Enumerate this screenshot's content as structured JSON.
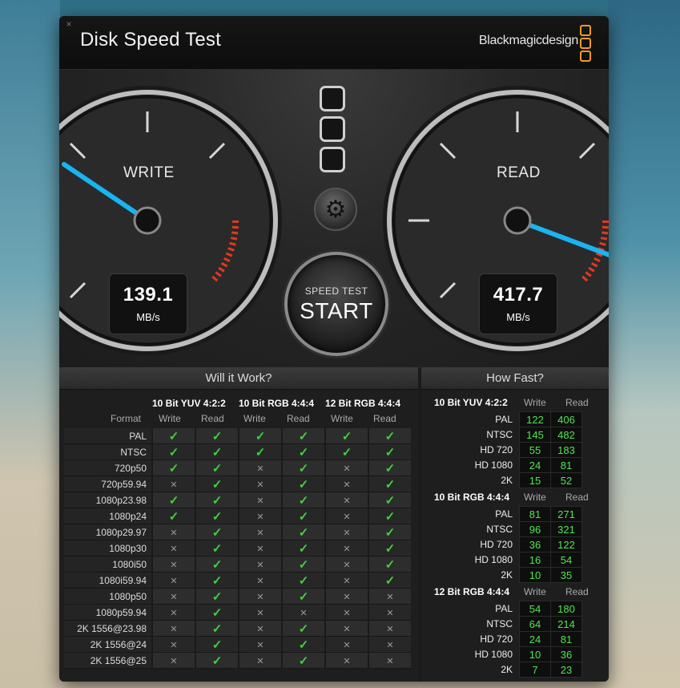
{
  "window": {
    "title": "Disk Speed Test",
    "brand": "Blackmagicdesign",
    "close_symbol": "×"
  },
  "gauges": {
    "write": {
      "label": "WRITE",
      "value": "139.1",
      "unit": "MB/s"
    },
    "read": {
      "label": "READ",
      "value": "417.7",
      "unit": "MB/s"
    }
  },
  "controls": {
    "speed_test_label": "SPEED TEST",
    "start_label": "START"
  },
  "will_it_work": {
    "title": "Will it Work?",
    "format_label": "Format",
    "groups": [
      "10 Bit YUV 4:2:2",
      "10 Bit RGB 4:4:4",
      "12 Bit RGB 4:4:4"
    ],
    "col_labels": [
      "Write",
      "Read",
      "Write",
      "Read",
      "Write",
      "Read"
    ],
    "rows": [
      {
        "format": "PAL",
        "cells": [
          1,
          1,
          1,
          1,
          1,
          1
        ]
      },
      {
        "format": "NTSC",
        "cells": [
          1,
          1,
          1,
          1,
          1,
          1
        ]
      },
      {
        "format": "720p50",
        "cells": [
          1,
          1,
          0,
          1,
          0,
          1
        ]
      },
      {
        "format": "720p59.94",
        "cells": [
          0,
          1,
          0,
          1,
          0,
          1
        ]
      },
      {
        "format": "1080p23.98",
        "cells": [
          1,
          1,
          0,
          1,
          0,
          1
        ]
      },
      {
        "format": "1080p24",
        "cells": [
          1,
          1,
          0,
          1,
          0,
          1
        ]
      },
      {
        "format": "1080p29.97",
        "cells": [
          0,
          1,
          0,
          1,
          0,
          1
        ]
      },
      {
        "format": "1080p30",
        "cells": [
          0,
          1,
          0,
          1,
          0,
          1
        ]
      },
      {
        "format": "1080i50",
        "cells": [
          0,
          1,
          0,
          1,
          0,
          1
        ]
      },
      {
        "format": "1080i59.94",
        "cells": [
          0,
          1,
          0,
          1,
          0,
          1
        ]
      },
      {
        "format": "1080p50",
        "cells": [
          0,
          1,
          0,
          1,
          0,
          0
        ]
      },
      {
        "format": "1080p59.94",
        "cells": [
          0,
          1,
          0,
          0,
          0,
          0
        ]
      },
      {
        "format": "2K 1556@23.98",
        "cells": [
          0,
          1,
          0,
          1,
          0,
          0
        ]
      },
      {
        "format": "2K 1556@24",
        "cells": [
          0,
          1,
          0,
          1,
          0,
          0
        ]
      },
      {
        "format": "2K 1556@25",
        "cells": [
          0,
          1,
          0,
          1,
          0,
          0
        ]
      }
    ]
  },
  "how_fast": {
    "title": "How Fast?",
    "sections": [
      {
        "name": "10 Bit YUV 4:2:2",
        "write_label": "Write",
        "read_label": "Read",
        "rows": [
          [
            "PAL",
            "122",
            "406"
          ],
          [
            "NTSC",
            "145",
            "482"
          ],
          [
            "HD 720",
            "55",
            "183"
          ],
          [
            "HD 1080",
            "24",
            "81"
          ],
          [
            "2K",
            "15",
            "52"
          ]
        ]
      },
      {
        "name": "10 Bit RGB 4:4:4",
        "write_label": "Write",
        "read_label": "Read",
        "rows": [
          [
            "PAL",
            "81",
            "271"
          ],
          [
            "NTSC",
            "96",
            "321"
          ],
          [
            "HD 720",
            "36",
            "122"
          ],
          [
            "HD 1080",
            "16",
            "54"
          ],
          [
            "2K",
            "10",
            "35"
          ]
        ]
      },
      {
        "name": "12 Bit RGB 4:4:4",
        "write_label": "Write",
        "read_label": "Read",
        "rows": [
          [
            "PAL",
            "54",
            "180"
          ],
          [
            "NTSC",
            "64",
            "214"
          ],
          [
            "HD 720",
            "24",
            "81"
          ],
          [
            "HD 1080",
            "10",
            "36"
          ],
          [
            "2K",
            "7",
            "23"
          ]
        ]
      }
    ]
  },
  "colors": {
    "needle": "#1ab4f0",
    "ok": "#3fd13f",
    "brand_orange": "#f59a20",
    "redline": "#e03a1e"
  }
}
